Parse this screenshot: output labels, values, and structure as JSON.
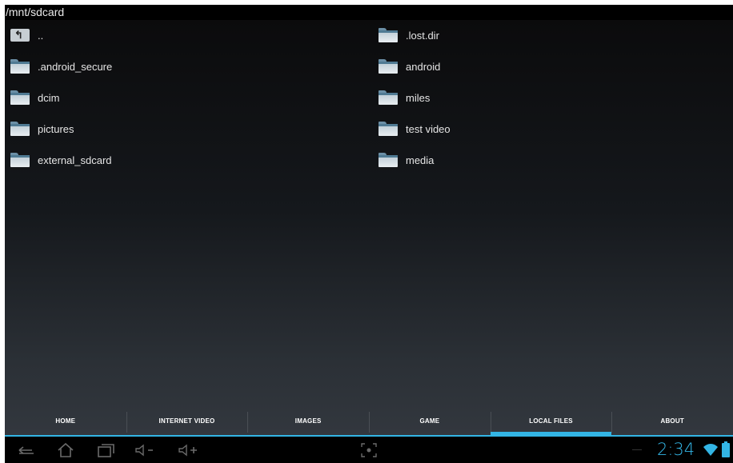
{
  "path": "/mnt/sdcard",
  "entries_left": [
    {
      "name": "..",
      "icon": "up-folder-icon"
    },
    {
      "name": ".android_secure",
      "icon": "folder-icon"
    },
    {
      "name": "dcim",
      "icon": "folder-icon"
    },
    {
      "name": "pictures",
      "icon": "folder-icon"
    },
    {
      "name": "external_sdcard",
      "icon": "folder-icon"
    }
  ],
  "entries_right": [
    {
      "name": ".lost.dir",
      "icon": "folder-icon"
    },
    {
      "name": "android",
      "icon": "folder-icon"
    },
    {
      "name": "miles",
      "icon": "folder-icon"
    },
    {
      "name": "test video",
      "icon": "folder-icon"
    },
    {
      "name": "media",
      "icon": "folder-icon"
    }
  ],
  "tabs": [
    {
      "label": "HOME",
      "active": false
    },
    {
      "label": "INTERNET VIDEO",
      "active": false
    },
    {
      "label": "IMAGES",
      "active": false
    },
    {
      "label": "GAME",
      "active": false
    },
    {
      "label": "LOCAL FILES",
      "active": true
    },
    {
      "label": "ABOUT",
      "active": false
    }
  ],
  "system": {
    "clock": "2:34",
    "accent_color": "#33b5e5",
    "nav_icons": [
      "back-icon",
      "home-icon",
      "recent-apps-icon",
      "volume-down-icon",
      "volume-up-icon",
      "screenshot-icon"
    ],
    "status_icons": [
      "wifi-icon",
      "battery-icon"
    ]
  }
}
